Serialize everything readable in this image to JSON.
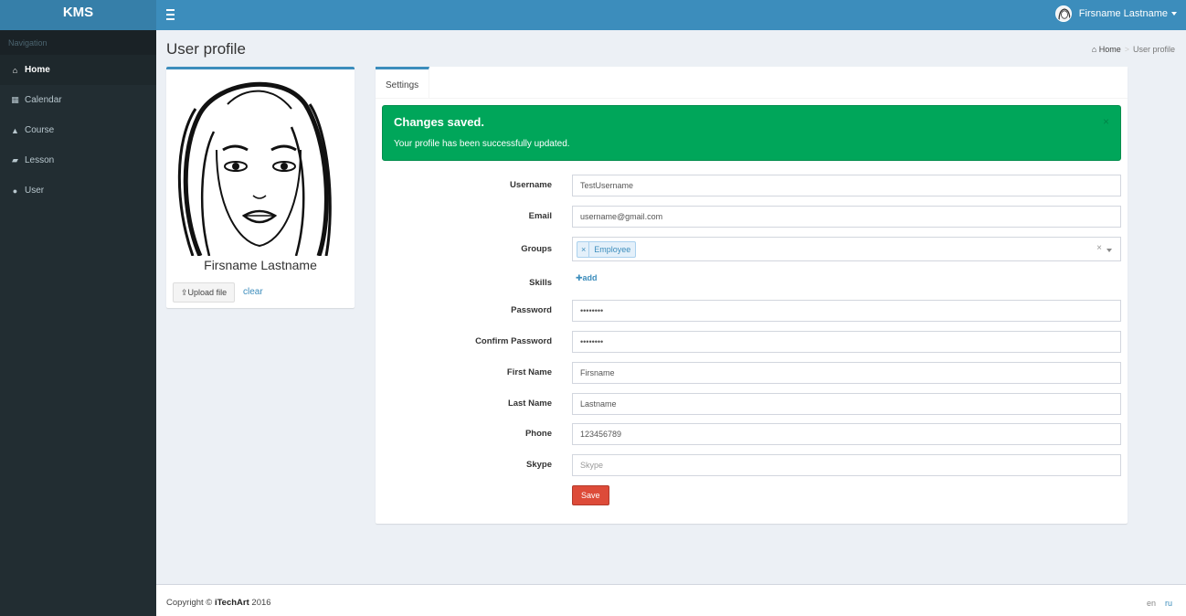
{
  "app": {
    "brand": "KMS"
  },
  "header": {
    "user_name": "Firsname Lastname"
  },
  "sidebar": {
    "header": "Navigation",
    "items": [
      {
        "label": "Home",
        "icon": "home-icon",
        "glyph": "⌂"
      },
      {
        "label": "Calendar",
        "icon": "calendar-icon",
        "glyph": "▦"
      },
      {
        "label": "Course",
        "icon": "graduation-cap-icon",
        "glyph": "▲"
      },
      {
        "label": "Lesson",
        "icon": "book-icon",
        "glyph": "▰"
      },
      {
        "label": "User",
        "icon": "user-icon",
        "glyph": "●"
      }
    ]
  },
  "page": {
    "title": "User profile",
    "breadcrumb": {
      "home": "Home",
      "current": "User profile"
    }
  },
  "profile": {
    "name": "Firsname Lastname",
    "upload_label": "Upload file",
    "clear_label": "clear"
  },
  "settings": {
    "tab_label": "Settings",
    "alert": {
      "title": "Changes saved.",
      "message": "Your profile has been successfully updated.",
      "close": "×"
    },
    "fields": {
      "username": {
        "label": "Username",
        "value": "TestUsername"
      },
      "email": {
        "label": "Email",
        "value": "username@gmail.com"
      },
      "groups": {
        "label": "Groups",
        "chip": "Employee",
        "chip_remove": "×",
        "clear": "×"
      },
      "skills": {
        "label": "Skills",
        "add": "add"
      },
      "password": {
        "label": "Password",
        "value": "••••••••"
      },
      "confirm_password": {
        "label": "Confirm Password",
        "value": "••••••••"
      },
      "first_name": {
        "label": "First Name",
        "value": "Firsname"
      },
      "last_name": {
        "label": "Last Name",
        "value": "Lastname"
      },
      "phone": {
        "label": "Phone",
        "value": "123456789"
      },
      "skype": {
        "label": "Skype",
        "value": "",
        "placeholder": "Skype"
      }
    },
    "save_label": "Save"
  },
  "footer": {
    "copyright_prefix": "Copyright © ",
    "company": "iTechArt",
    "year": " 2016",
    "lang_en": "en",
    "lang_ru": "ru"
  },
  "colors": {
    "navbar": "#3c8dbc",
    "brand_bg": "#367fa9",
    "sidebar": "#222d32",
    "alert_success": "#00a65a",
    "save_button": "#dd4b39"
  }
}
